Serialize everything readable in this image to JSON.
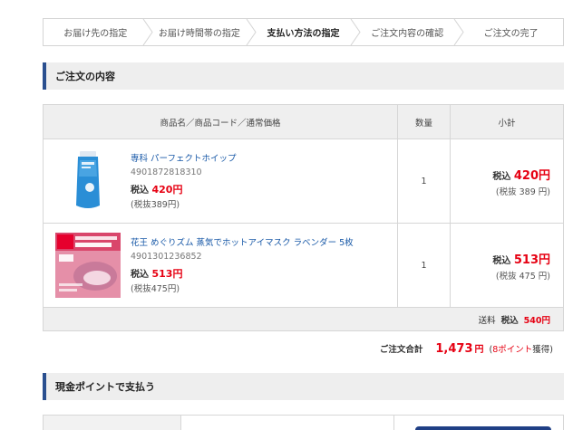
{
  "steps": [
    {
      "label": "お届け先の指定",
      "state": "done"
    },
    {
      "label": "お届け時間帯の指定",
      "state": "done"
    },
    {
      "label": "支払い方法の指定",
      "state": "active"
    },
    {
      "label": "ご注文内容の確認",
      "state": "todo"
    },
    {
      "label": "ご注文の完了",
      "state": "todo"
    }
  ],
  "order_section": {
    "title": "ご注文の内容"
  },
  "table": {
    "headers": {
      "product": "商品名／商品コード／通常価格",
      "qty": "数量",
      "subtotal": "小計"
    },
    "rows": [
      {
        "name": "専科 パーフェクトホイップ",
        "code": "4901872818310",
        "price_prefix": "税込",
        "price": "420円",
        "price_ex": "(税抜389円)",
        "qty": "1",
        "sub_prefix": "税込",
        "sub_num": "420円",
        "sub_ex": "(税抜 389 円)"
      },
      {
        "name": "花王 めぐりズム 蒸気でホットアイマスク ラベンダー 5枚",
        "code": "4901301236852",
        "price_prefix": "税込",
        "price": "513円",
        "price_ex": "(税抜475円)",
        "qty": "1",
        "sub_prefix": "税込",
        "sub_num": "513円",
        "sub_ex": "(税抜 475 円)"
      }
    ],
    "shipping": {
      "label": "送料",
      "prefix": "税込",
      "value": "540円"
    }
  },
  "total": {
    "label": "ご注文合計",
    "value": "1,473",
    "yen": "円",
    "paren_open": "(",
    "points": "8ポイント",
    "points_suffix": "獲得)"
  },
  "points_section": {
    "title": "現金ポイントで支払う"
  },
  "colors": {
    "accent": "#2a4f8f",
    "price": "#e60012",
    "link": "#1a5aa8",
    "button": "#1f3f85"
  }
}
